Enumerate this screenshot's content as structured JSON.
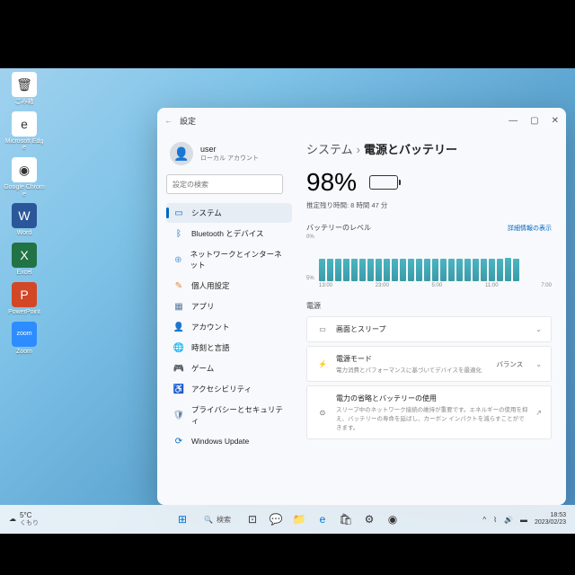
{
  "desktop_icons": [
    {
      "label": "ごみ箱",
      "bg": "#fff",
      "glyph": "🗑"
    },
    {
      "label": "Microsoft Edge",
      "bg": "#fff",
      "glyph": "e"
    },
    {
      "label": "Google Chrome",
      "bg": "#fff",
      "glyph": "◉"
    },
    {
      "label": "Word",
      "bg": "#2b579a",
      "glyph": "W"
    },
    {
      "label": "Excel",
      "bg": "#217346",
      "glyph": "X"
    },
    {
      "label": "PowerPoint",
      "bg": "#d24726",
      "glyph": "P"
    },
    {
      "label": "Zoom",
      "bg": "#2d8cff",
      "glyph": "zoom"
    }
  ],
  "window": {
    "title": "設定",
    "user": {
      "name": "user",
      "type": "ローカル アカウント"
    },
    "search_placeholder": "設定の検索",
    "nav": [
      {
        "icon": "▭",
        "color": "#0067c0",
        "label": "システム",
        "active": true
      },
      {
        "icon": "ᛒ",
        "color": "#0067c0",
        "label": "Bluetooth とデバイス"
      },
      {
        "icon": "⊕",
        "color": "#5aa0d8",
        "label": "ネットワークとインターネット"
      },
      {
        "icon": "✎",
        "color": "#e58a3c",
        "label": "個人用設定"
      },
      {
        "icon": "▦",
        "color": "#5a7ca0",
        "label": "アプリ"
      },
      {
        "icon": "👤",
        "color": "#c85c5c",
        "label": "アカウント"
      },
      {
        "icon": "🌐",
        "color": "#3a9ba7",
        "label": "時刻と言語"
      },
      {
        "icon": "🎮",
        "color": "#7a8a95",
        "label": "ゲーム"
      },
      {
        "icon": "♿",
        "color": "#5a7ca0",
        "label": "アクセシビリティ"
      },
      {
        "icon": "🛡",
        "color": "#5a7ca0",
        "label": "プライバシーとセキュリティ"
      },
      {
        "icon": "⟳",
        "color": "#0067c0",
        "label": "Windows Update"
      }
    ],
    "breadcrumb": {
      "parent": "システム",
      "current": "電源とバッテリー"
    },
    "battery": {
      "percent": "98%",
      "estimate": "推定残り時間: 8 時間 47 分"
    },
    "level_label": "バッテリーのレベル",
    "detail_link": "詳細情報の表示",
    "ylabels": [
      "0%",
      "5%"
    ],
    "xlabels": [
      "13:00",
      "23:00",
      "5:00",
      "11:00",
      "7:00"
    ],
    "power_section": "電源",
    "cards": [
      {
        "icon": "▭",
        "title": "画面とスリープ",
        "sub": "",
        "val": "",
        "chev": "⌄"
      },
      {
        "icon": "⚡",
        "title": "電源モード",
        "sub": "電力消費とパフォーマンスに基づいてデバイスを最適化",
        "val": "バランス",
        "chev": "⌄"
      },
      {
        "icon": "⊙",
        "title": "電力の省略とバッテリーの使用",
        "sub": "スリープ中のネットワーク接続の維持が重要です。エネルギーの使用を抑え、バッテリーの寿命を延ばし、カーボン インパクトを減らすことができます。",
        "val": "",
        "chev": "↗"
      }
    ]
  },
  "taskbar": {
    "weather": {
      "temp": "5°C",
      "desc": "くもり"
    },
    "search": "検索",
    "time": "18:53",
    "date": "2023/02/23"
  },
  "chart_data": {
    "type": "bar",
    "title": "バッテリーのレベル",
    "ylabel": "%",
    "ylim": [
      0,
      100
    ],
    "x_start": "13:00",
    "x_end": "7:00",
    "values": [
      98,
      97,
      98,
      97,
      98,
      98,
      97,
      98,
      98,
      97,
      98,
      98,
      98,
      98,
      98,
      98,
      97,
      98,
      98,
      98,
      98,
      98,
      98,
      99,
      98
    ]
  }
}
